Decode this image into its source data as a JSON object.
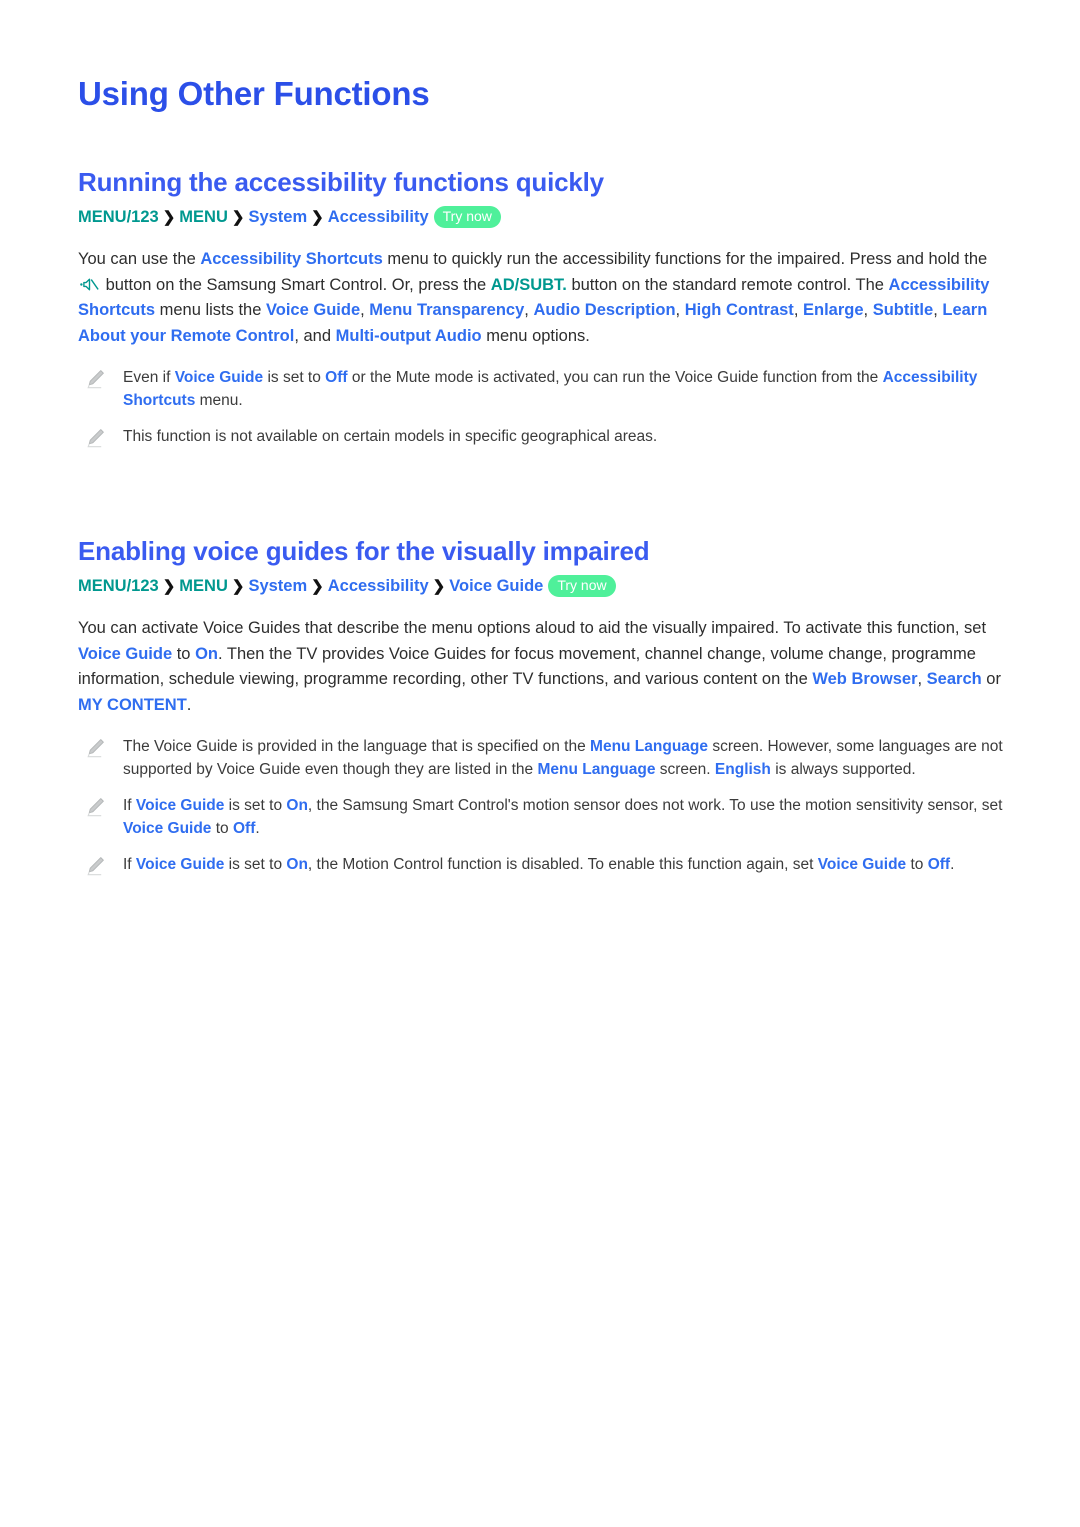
{
  "document": {
    "title": "Using Other Functions",
    "colors": {
      "title_blue": "#2b4fe8",
      "heading_blue": "#3a5bf0",
      "link_blue": "#2f6df0",
      "teal": "#00988f",
      "try_now_green": "#4ff09a",
      "body_text": "#2d2d2d"
    }
  },
  "sections": [
    {
      "heading": "Running the accessibility functions quickly",
      "breadcrumb": {
        "items": [
          {
            "label": "MENU/123",
            "style": "teal"
          },
          {
            "label": "MENU",
            "style": "teal"
          },
          {
            "label": "System",
            "style": "blue"
          },
          {
            "label": "Accessibility",
            "style": "blue"
          }
        ],
        "separator": "❯",
        "badge": "Try now"
      },
      "paragraph": {
        "p1": "You can use the ",
        "l1": "Accessibility Shortcuts",
        "p2": " menu to quickly run the accessibility functions for the impaired. Press and hold the ",
        "icon": "mute-icon",
        "p3": " button on the Samsung Smart Control. Or, press the ",
        "l2": "AD/SUBT.",
        "p4": " button on the standard remote control. The ",
        "l3": "Accessibility Shortcuts",
        "p5": " menu lists the ",
        "l4": "Voice Guide",
        "p6": ", ",
        "l5": "Menu Transparency",
        "p7": ", ",
        "l6": "Audio Description",
        "p8": ", ",
        "l7": "High Contrast",
        "p9": ", ",
        "l8": "Enlarge",
        "p10": ", ",
        "l9": "Subtitle",
        "p11": ", ",
        "l10": "Learn About your Remote Control",
        "p12": ", and ",
        "l11": "Multi-output Audio",
        "p13": " menu options."
      },
      "notes": [
        {
          "n1": "Even if ",
          "b1": "Voice Guide",
          "n2": " is set to ",
          "b2": "Off",
          "n3": " or the Mute mode is activated, you can run the Voice Guide function from the ",
          "b3": "Accessibility Shortcuts",
          "n4": " menu."
        },
        {
          "n1": "This function is not available on certain models in specific geographical areas."
        }
      ]
    },
    {
      "heading": "Enabling voice guides for the visually impaired",
      "breadcrumb": {
        "items": [
          {
            "label": "MENU/123",
            "style": "teal"
          },
          {
            "label": "MENU",
            "style": "teal"
          },
          {
            "label": "System",
            "style": "blue"
          },
          {
            "label": "Accessibility",
            "style": "blue"
          },
          {
            "label": "Voice Guide",
            "style": "blue"
          }
        ],
        "separator": "❯",
        "badge": "Try now"
      },
      "paragraph": {
        "p1": "You can activate Voice Guides that describe the menu options aloud to aid the visually impaired. To activate this function, set ",
        "l1": "Voice Guide",
        "p2": " to ",
        "l2": "On",
        "p3": ". Then the TV provides Voice Guides for focus movement, channel change, volume change, programme information, schedule viewing, programme recording, other TV functions, and various content on the ",
        "l3": "Web Browser",
        "p4": ", ",
        "l4": "Search",
        "p5": " or ",
        "l5": "MY CONTENT",
        "p6": "."
      },
      "notes": [
        {
          "n1": "The Voice Guide is provided in the language that is specified on the ",
          "b1": "Menu Language",
          "n2": " screen. However, some languages are not supported by Voice Guide even though they are listed in the ",
          "b2": "Menu Language",
          "n3": " screen. ",
          "b3": "English",
          "n4": " is always supported."
        },
        {
          "n1": "If ",
          "b1": "Voice Guide",
          "n2": " is set to ",
          "b2": "On",
          "n3": ", the Samsung Smart Control's motion sensor does not work. To use the motion sensitivity sensor, set ",
          "b3": "Voice Guide",
          "n4": " to ",
          "b4": "Off",
          "n5": "."
        },
        {
          "n1": "If ",
          "b1": "Voice Guide",
          "n2": " is set to ",
          "b2": "On",
          "n3": ", the Motion Control function is disabled. To enable this function again, set ",
          "b3": "Voice Guide",
          "n4": " to ",
          "b4": "Off",
          "n5": "."
        }
      ]
    }
  ]
}
